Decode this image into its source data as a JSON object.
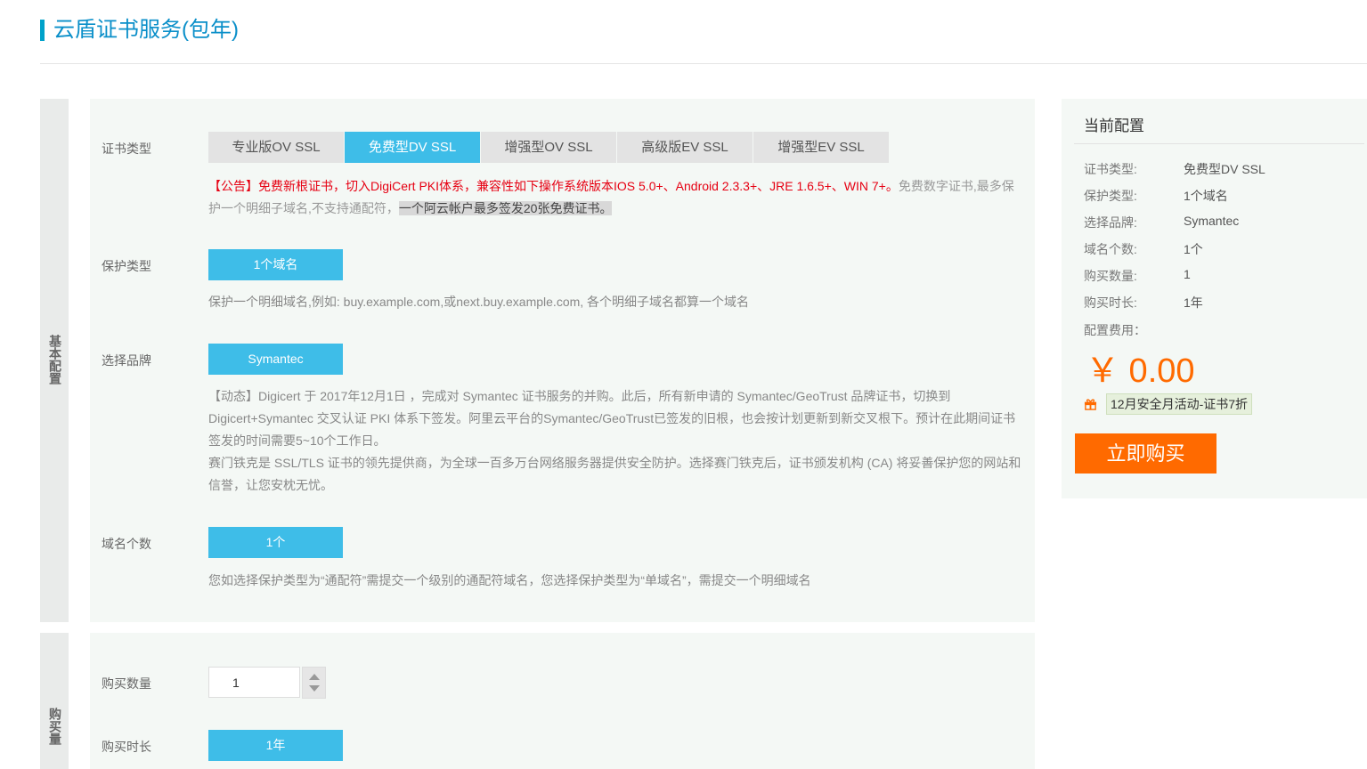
{
  "header": {
    "title": "云盾证书服务(包年)"
  },
  "basic": {
    "side_label": "基本配置",
    "cert_type": {
      "label": "证书类型",
      "tabs": [
        "专业版OV SSL",
        "免费型DV SSL",
        "增强型OV SSL",
        "高级版EV SSL",
        "增强型EV SSL"
      ],
      "active_index": 1,
      "notice_red": "【公告】免费新根证书，切入DigiCert PKI体系，兼容性如下操作系统版本IOS 5.0+、Android 2.3.3+、JRE 1.6.5+、WIN 7+。",
      "notice_gray": "免费数字证书,最多保护一个明细子域名,不支持通配符，",
      "notice_highlight": "一个阿云帐户最多签发20张免费证书。"
    },
    "protect_type": {
      "label": "保护类型",
      "option": "1个域名",
      "desc": "保护一个明细域名,例如: buy.example.com,或next.buy.example.com, 各个明细子域名都算一个域名"
    },
    "brand": {
      "label": "选择品牌",
      "option": "Symantec",
      "desc_line1": "【动态】Digicert 于 2017年12月1日 ，完成对 Symantec 证书服务的并购。此后，所有新申请的 Symantec/GeoTrust 品牌证书，切换到 Digicert+Symantec 交叉认证 PKI 体系下签发。阿里云平台的Symantec/GeoTrust已签发的旧根，也会按计划更新到新交叉根下。预计在此期间证书签发的时间需要5~10个工作日。",
      "desc_line2": "赛门铁克是 SSL/TLS 证书的领先提供商，为全球一百多万台网络服务器提供安全防护。选择赛门铁克后，证书颁发机构 (CA) 将妥善保护您的网站和信誉，让您安枕无忧。"
    },
    "domain_count": {
      "label": "域名个数",
      "option": "1个",
      "desc": "您如选择保护类型为“通配符”需提交一个级别的通配符域名，您选择保护类型为“单域名”，需提交一个明细域名"
    }
  },
  "purchase": {
    "side_label": "购买量",
    "quantity": {
      "label": "购买数量",
      "value": "1"
    },
    "duration": {
      "label": "购买时长",
      "option": "1年"
    }
  },
  "summary": {
    "title": "当前配置",
    "rows": [
      {
        "key": "证书类型:",
        "value": "免费型DV SSL"
      },
      {
        "key": "保护类型:",
        "value": "1个域名"
      },
      {
        "key": "选择品牌:",
        "value": "Symantec"
      },
      {
        "key": "域名个数:",
        "value": "1个"
      },
      {
        "key": "购买数量:",
        "value": "1"
      },
      {
        "key": "购买时长:",
        "value": "1年"
      }
    ],
    "fee_label": "配置费用：",
    "price": "￥ 0.00",
    "promo": "12月安全月活动-证书7折",
    "buy_label": "立即购买"
  },
  "colors": {
    "accent": "#3ebde8",
    "title": "#0a8fc9",
    "orange": "#ff6a00",
    "red": "#e60012"
  }
}
